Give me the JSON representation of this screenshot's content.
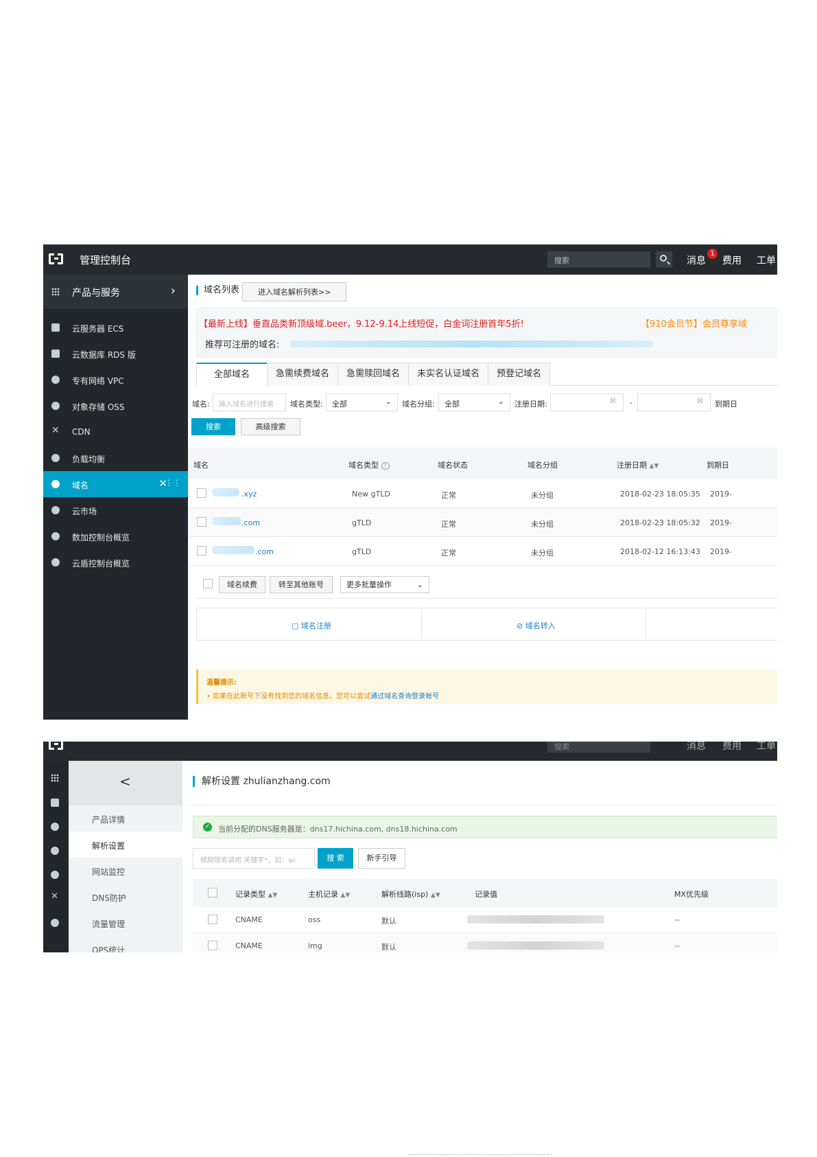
{
  "shot1": {
    "header": {
      "console_title": "管理控制台",
      "search_placeholder": "搜索",
      "nav": {
        "messages": "消息",
        "messages_badge": "1",
        "fees": "费用",
        "tickets": "工单"
      }
    },
    "sidebar": {
      "head": "产品与服务",
      "items": [
        {
          "label": "云服务器 ECS",
          "icon": "server-icon"
        },
        {
          "label": "云数据库 RDS 版",
          "icon": "database-icon"
        },
        {
          "label": "专有网络 VPC",
          "icon": "cloud-icon"
        },
        {
          "label": "对象存储 OSS",
          "icon": "storage-icon"
        },
        {
          "label": "CDN",
          "icon": "cdn-icon"
        },
        {
          "label": "负载均衡",
          "icon": "load-balancer-icon"
        },
        {
          "label": "域名",
          "icon": "globe-icon",
          "active": true
        },
        {
          "label": "云市场",
          "icon": "market-icon"
        },
        {
          "label": "数加控制台概览",
          "icon": "dot-icon"
        },
        {
          "label": "云盾控制台概览",
          "icon": "dot-icon"
        }
      ]
    },
    "main": {
      "page_title": "域名列表",
      "goto_button": "进入域名解析列表>>",
      "promo_red": "【最新上线】垂直品类新顶级域.beer，9.12-9.14上线短促，白金词注册首年5折!",
      "promo_orange": "【910会员节】会员尊享域",
      "recommend_label": "推荐可注册的域名:",
      "tabs": [
        "全部域名",
        "急需续费域名",
        "急需赎回域名",
        "未实名认证域名",
        "预登记域名"
      ],
      "filter": {
        "domain_label": "域名:",
        "domain_placeholder": "输入域名进行搜索",
        "type_label": "域名类型:",
        "type_value": "全部",
        "group_label": "域名分组:",
        "group_value": "全部",
        "reg_date_label": "注册日期:",
        "dash": "-",
        "expire_label": "到期日",
        "search_button": "搜索",
        "advanced_button": "高级搜索"
      },
      "table": {
        "headers": [
          "域名",
          "域名类型",
          "域名状态",
          "域名分组",
          "注册日期",
          "到期日"
        ],
        "rows": [
          {
            "domain": ".xyz",
            "type": "New gTLD",
            "status": "正常",
            "group": "未分组",
            "reg": "2018-02-23 18:05:35",
            "exp": "2019-"
          },
          {
            "domain": ".com",
            "type": "gTLD",
            "status": "正常",
            "group": "未分组",
            "reg": "2018-02-23 18:05:32",
            "exp": "2019-"
          },
          {
            "domain": ".com",
            "type": "gTLD",
            "status": "正常",
            "group": "未分组",
            "reg": "2018-02-12 16:13:43",
            "exp": "2019-"
          }
        ]
      },
      "bulk": {
        "renew": "域名续费",
        "transfer": "转至其他账号",
        "more": "更多批量操作"
      },
      "actions": {
        "register": "域名注册",
        "transfer_in": "域名转入"
      },
      "tip": {
        "title": "温馨提示:",
        "text": "• 如果在此账号下没有找到您的域名信息，您可以尝试",
        "link": "通过域名查询登录帐号"
      }
    }
  },
  "shot2": {
    "header": {
      "search_placeholder": "搜索",
      "messages": "消息",
      "fees": "费用",
      "tickets": "工单"
    },
    "subnav": {
      "back": "<",
      "items": [
        {
          "label": "产品详情"
        },
        {
          "label": "解析设置",
          "active": true
        },
        {
          "label": "网站监控"
        },
        {
          "label": "DNS防护"
        },
        {
          "label": "流量管理"
        },
        {
          "label": "QPS统计"
        }
      ]
    },
    "main": {
      "title": "解析设置 zhulianzhang.com",
      "dns_info": "当前分配的DNS服务器是：dns17.hichina.com, dns18.hichina.com",
      "search_placeholder": "模糊搜索请用 关键字*，如：wi",
      "search_button": "搜 索",
      "guide_button": "新手引导",
      "table": {
        "headers": [
          "记录类型",
          "主机记录",
          "解析线路(isp)",
          "记录值",
          "MX优先级"
        ],
        "rows": [
          {
            "type": "CNAME",
            "host": "oss",
            "line": "默认",
            "mx": "--"
          },
          {
            "type": "CNAME",
            "host": "img",
            "line": "默认",
            "mx": "--"
          }
        ]
      }
    }
  }
}
